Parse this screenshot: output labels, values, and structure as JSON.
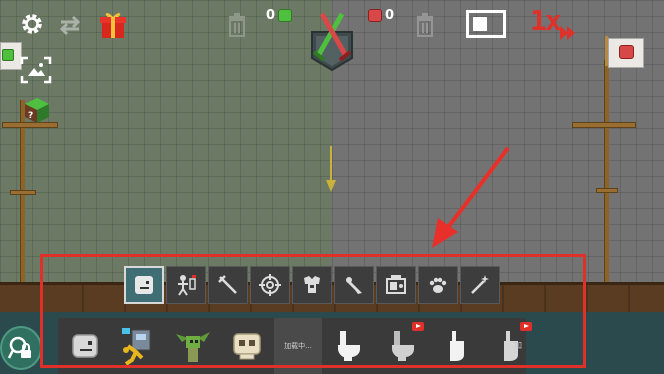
{
  "hud": {
    "green_score": "0",
    "red_score": "0",
    "speed_label": "1x",
    "colors": {
      "green_team": "#4fbf3f",
      "red_team": "#d84848",
      "highlight": "#e0302a",
      "active_tab": "#3f6f74"
    }
  },
  "icons": {
    "settings": "gear-icon",
    "swap": "swap-icon",
    "gift": "gift-icon",
    "trash": "trash-icon",
    "emblem": "crossed-swords-emblem-icon",
    "layout": "layout-toggle-icon",
    "photo": "photo-frame-icon",
    "dice": "dice-icon",
    "lock": "lock-icon"
  },
  "categories": [
    {
      "name": "blocks",
      "icon": "block-face-icon",
      "active": true
    },
    {
      "name": "characters",
      "icon": "skeleton-icon",
      "active": false
    },
    {
      "name": "melee",
      "icon": "melee-weapon-icon",
      "active": false
    },
    {
      "name": "ranged",
      "icon": "crosshair-icon",
      "active": false
    },
    {
      "name": "armor",
      "icon": "armor-icon",
      "active": false
    },
    {
      "name": "explosives",
      "icon": "rocket-icon",
      "active": false
    },
    {
      "name": "machines",
      "icon": "machine-icon",
      "active": false
    },
    {
      "name": "animals",
      "icon": "paw-icon",
      "active": false
    },
    {
      "name": "magic",
      "icon": "magic-wand-icon",
      "active": false
    }
  ],
  "items": [
    {
      "name": "stone-head",
      "icon": "stone-head-icon"
    },
    {
      "name": "robot-figure",
      "icon": "robot-figure-icon"
    },
    {
      "name": "goblin",
      "icon": "goblin-icon"
    },
    {
      "name": "skull",
      "icon": "skull-icon"
    },
    {
      "name": "loading",
      "label": "加载中..."
    },
    {
      "name": "toilet",
      "icon": "toilet-icon",
      "video": false
    },
    {
      "name": "toilet-video",
      "icon": "toilet-icon",
      "video": true
    },
    {
      "name": "urinal",
      "icon": "urinal-icon",
      "video": false
    },
    {
      "name": "urinal-video",
      "icon": "urinal-icon",
      "video": true
    }
  ],
  "itembar_more": "加"
}
